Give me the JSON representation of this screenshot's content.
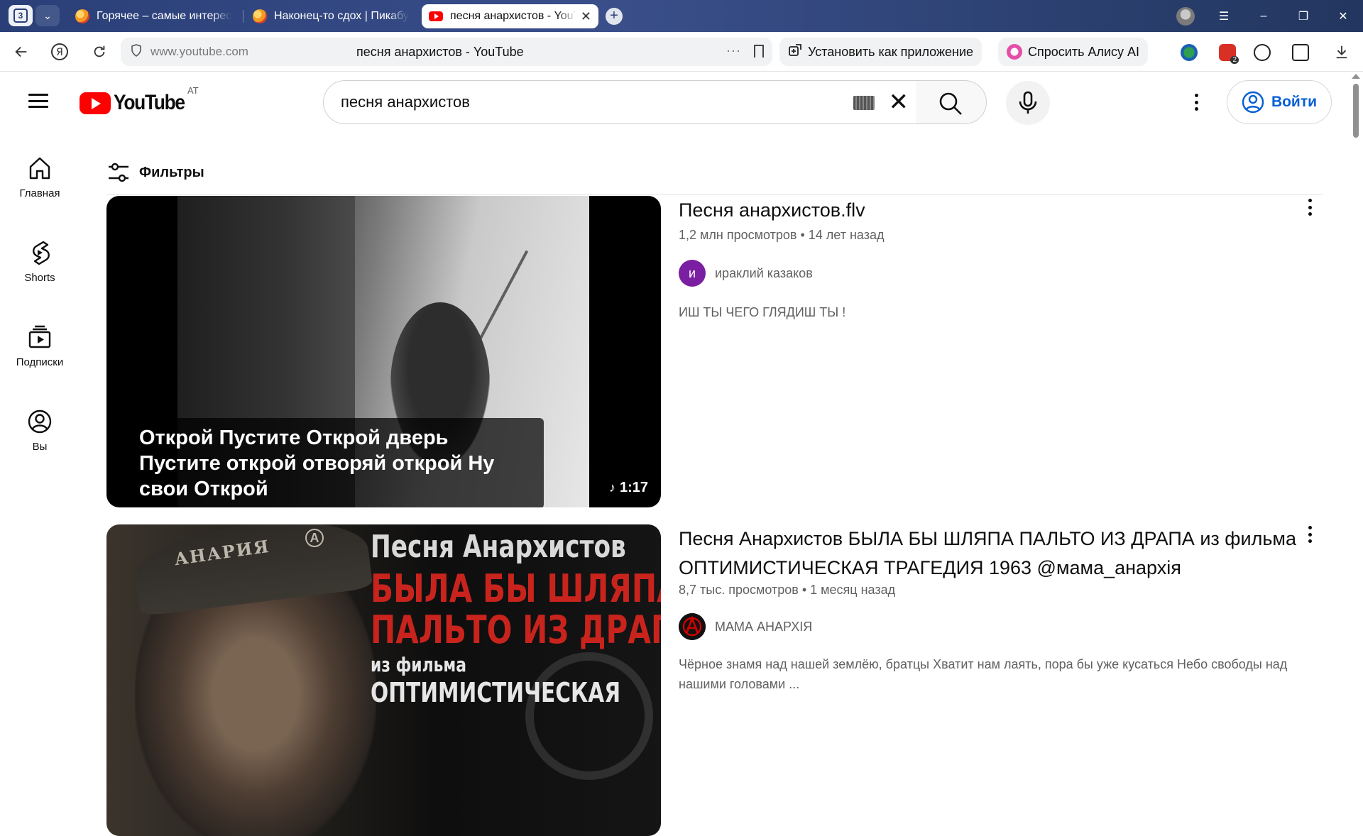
{
  "browser": {
    "tab_count": "3",
    "tabs": [
      {
        "label": "Горячее – самые интерес"
      },
      {
        "label": "Наконец-то сдох | Пикабу"
      },
      {
        "label": "песня анархистов - YouTube"
      }
    ],
    "address": {
      "domain": "www.youtube.com",
      "page_title": "песня анархистов - YouTube"
    },
    "install_app_label": "Установить как приложение",
    "ask_alice_label": "Спросить Алису AI",
    "ext_badge": "2"
  },
  "youtube": {
    "logo_text": "YouTube",
    "country_code": "AT",
    "search": {
      "value": "песня анархистов"
    },
    "signin_label": "Войти",
    "guide": [
      {
        "label": "Главная",
        "icon": "home-icon"
      },
      {
        "label": "Shorts",
        "icon": "shorts-icon"
      },
      {
        "label": "Подписки",
        "icon": "subscriptions-icon"
      },
      {
        "label": "Вы",
        "icon": "you-icon"
      }
    ],
    "filters_label": "Фильтры",
    "results": [
      {
        "title": "Песня анархистов.flv",
        "views": "1,2 млн просмотров",
        "age": "14 лет назад",
        "channel": "ираклий казаков",
        "channel_initial": "и",
        "description": "ИШ ТЫ ЧЕГО ГЛЯДИШ ТЫ !",
        "thumbnail_caption": "Открой Пустите Открой дверь Пустите открой отворяй открой Ну свои Открой",
        "duration": "1:17"
      },
      {
        "title": "Песня Анархистов БЫЛА БЫ ШЛЯПА ПАЛЬТО ИЗ ДРАПА из фильма ОПТИМИСТИЧЕСКАЯ ТРАГЕДИЯ 1963 @мама_анархія",
        "views": "8,7 тыс. просмотров",
        "age": "1 месяц назад",
        "channel": "МАМА АНАРХІЯ",
        "description": "Чёрное знамя над нашей землёю, братцы Хватит нам лаять, пора бы уже кусаться Небо свободы над нашими головами ...",
        "thumbnail_text": {
          "cap": "АНАРИЯ",
          "line1": "Песня Анархистов",
          "line2": "БЫЛА БЫ ШЛЯПА",
          "line3": "ПАЛЬТО ИЗ ДРАПА",
          "line4": "из фильма",
          "line5": "ОПТИМИСТИЧЕСКАЯ"
        }
      }
    ]
  },
  "colors": {
    "brand_red": "#ff0000",
    "link_blue": "#065fd4",
    "channel_avatar_purple": "#7b1fa2",
    "tabstrip": "#2a3f78"
  }
}
